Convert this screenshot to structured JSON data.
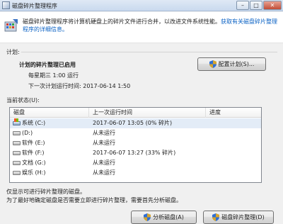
{
  "window": {
    "title": "磁盘碎片整理程序",
    "minimize": "–",
    "maximize": "□",
    "close": "✕"
  },
  "intro": {
    "text": "磁盘碎片整理程序将计算机硬盘上的碎片文件进行合并，以改进文件系统性能。",
    "link": "获取有关磁盘碎片整理程序的详细信息。"
  },
  "schedule": {
    "section_label": "计划:",
    "title": "计划的碎片整理已启用",
    "frequency": "每星期三 1:00 运行",
    "next_run": "下一次计划运行时间: 2017-06-14 1:50",
    "configure_button": "配置计划(S)..."
  },
  "status": {
    "section_label": "当前状态(U):",
    "columns": [
      "磁盘",
      "上一次运行时间",
      "进度"
    ],
    "rows": [
      {
        "disk": "系统 (C:)",
        "last_run": "2017-06-07 13:05 (0% 碎片)",
        "progress": "",
        "system": true
      },
      {
        "disk": "(D:)",
        "last_run": "从未运行",
        "progress": ""
      },
      {
        "disk": "软件 (E:)",
        "last_run": "从未运行",
        "progress": ""
      },
      {
        "disk": "软件 (F:)",
        "last_run": "2017-06-07 13:27 (33% 碎片)",
        "progress": ""
      },
      {
        "disk": "文档 (G:)",
        "last_run": "从未运行",
        "progress": ""
      },
      {
        "disk": "娱乐 (H:)",
        "last_run": "从未运行",
        "progress": ""
      }
    ]
  },
  "notes": {
    "line1": "仅显示可进行碎片整理的磁盘。",
    "line2": "为了最好地确定磁盘是否需要立即进行碎片整理，需要首先分析磁盘。"
  },
  "actions": {
    "analyze_button": "分析磁盘(A)",
    "defrag_button": "磁盘碎片整理(D)"
  }
}
